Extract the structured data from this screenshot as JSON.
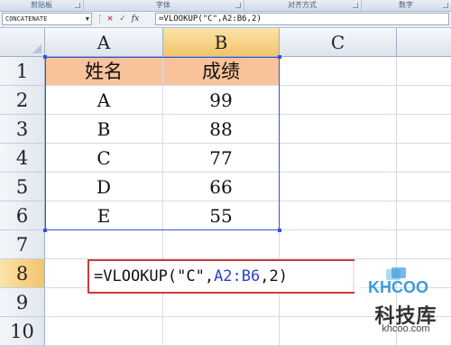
{
  "ribbon": {
    "groups": [
      "剪贴板",
      "字体",
      "对齐方式",
      "数字"
    ]
  },
  "formula_bar": {
    "name_box": "CONCATENATE",
    "name_box_dropdown": "▼",
    "cancel_icon": "×",
    "enter_icon": "✓",
    "fx_label": "fx",
    "formula": "=VLOOKUP(\"C\",A2:B6,2)"
  },
  "columns": [
    "A",
    "B",
    "C"
  ],
  "rows": [
    "1",
    "2",
    "3",
    "4",
    "5",
    "6",
    "7",
    "8",
    "9",
    "10"
  ],
  "table": {
    "headers": [
      "姓名",
      "成绩"
    ],
    "data": [
      [
        "A",
        "99"
      ],
      [
        "B",
        "88"
      ],
      [
        "C",
        "77"
      ],
      [
        "D",
        "66"
      ],
      [
        "E",
        "55"
      ]
    ]
  },
  "formula_cell": {
    "prefix": "=VLOOKUP(\"C\",",
    "ref": "A2:B6",
    "suffix": ",2)"
  },
  "watermark": {
    "logo_text": "KHCOO",
    "chinese": "科技库",
    "domain": "khcoo.com"
  },
  "colors": {
    "header_fill": "#f8c39a",
    "range_border": "#3b4fd4",
    "formula_border": "#cf3b3b",
    "column_selected": "#f3c46b",
    "logo_blue": "#3d9bd8"
  }
}
